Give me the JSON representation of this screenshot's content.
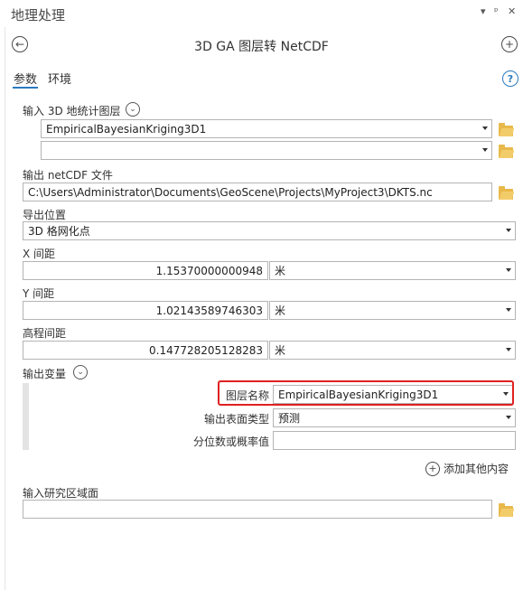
{
  "panel": {
    "title": "地理处理",
    "controls": {
      "dropdown": "▾",
      "pin": "🖈",
      "close": "✕"
    }
  },
  "tool": {
    "title": "3D GA 图层转 NetCDF"
  },
  "tabs": [
    {
      "label": "参数"
    },
    {
      "label": "环境"
    }
  ],
  "help": {
    "glyph": "?"
  },
  "input_layer": {
    "label": "输入 3D 地统计图层",
    "values": [
      "EmpiricalBayesianKriging3D1",
      ""
    ]
  },
  "output_file": {
    "label": "输出 netCDF 文件",
    "value": "C:\\Users\\Administrator\\Documents\\GeoScene\\Projects\\MyProject3\\DKTS.nc"
  },
  "export_location": {
    "label": "导出位置",
    "value": "3D 格网化点"
  },
  "x_spacing": {
    "label": "X 间距",
    "value": "1.15370000000948",
    "unit": "米"
  },
  "y_spacing": {
    "label": "Y 间距",
    "value": "1.02143589746303",
    "unit": "米"
  },
  "z_spacing": {
    "label": "高程间距",
    "value": "0.147728205128283",
    "unit": "米"
  },
  "output_variables": {
    "label": "输出变量",
    "layer_name_label": "图层名称",
    "layer_name_value": "EmpiricalBayesianKriging3D1",
    "surface_type_label": "输出表面类型",
    "surface_type_value": "预测",
    "quantile_label": "分位数或概率值",
    "quantile_value": "",
    "add_more_label": "添加其他内容"
  },
  "study_area": {
    "label": "输入研究区域面",
    "value": ""
  },
  "colors": {
    "accent": "#2a7abf",
    "highlight": "#e02020",
    "folder": "#e8b84a"
  }
}
